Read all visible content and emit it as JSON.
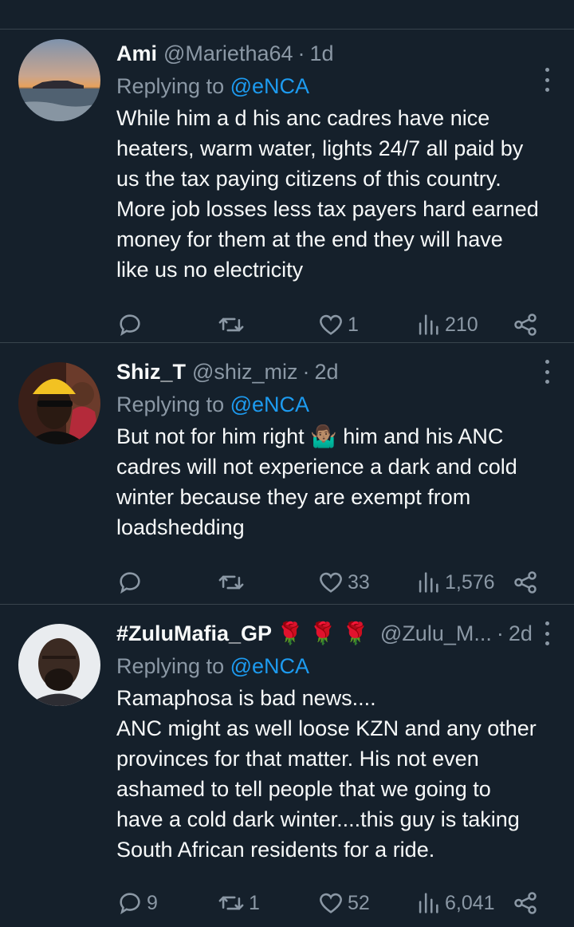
{
  "colors": {
    "background": "#15202b",
    "text": "#f7f9f9",
    "muted": "#8b98a5",
    "link": "#1d9bf0",
    "divider": "#38444d"
  },
  "replies": [
    {
      "name": "Ami",
      "handle": "@Marietha64",
      "time": "1d",
      "replying_prefix": "Replying to",
      "replying_handle": "@eNCA",
      "text": "While him a d his anc cadres have nice\nheaters, warm water, lights 24/7 all paid by\nus the tax paying citizens of this country.\nMore job losses less tax payers hard earned\nmoney for them at the end they will have\nlike us no electricity",
      "replies_count": "",
      "retweets_count": "",
      "likes_count": "1",
      "views_count": "210",
      "avatar": "sunset-beach-photo"
    },
    {
      "name": "Shiz_T",
      "handle": "@shiz_miz",
      "time": "2d",
      "replying_prefix": "Replying to",
      "replying_handle": "@eNCA",
      "text_before_emoji": "But not for him right ",
      "inline_emoji": "🤷🏽‍♂️",
      "text_after_emoji": " him and his ANC\ncadres will not experience a dark and cold\nwinter because they are exempt from\nloadshedding",
      "replies_count": "",
      "retweets_count": "",
      "likes_count": "33",
      "views_count": "1,576",
      "avatar": "man-yellow-beanie-photo"
    },
    {
      "name": "#ZuluMafia_GP",
      "name_emojis": "🌹 🌹 🌹",
      "handle": "@Zulu_M...",
      "time": "2d",
      "replying_prefix": "Replying to",
      "replying_handle": "@eNCA",
      "text": "Ramaphosa is bad news....\nANC might as well loose KZN and any other\nprovinces for that matter. His not even\nashamed to tell people that we going to\nhave a cold dark winter....this guy is taking\nSouth African residents for a ride.",
      "replies_count": "9",
      "retweets_count": "1",
      "likes_count": "52",
      "views_count": "6,041",
      "avatar": "man-portrait-photo"
    }
  ],
  "icons": {
    "reply": "reply-bubble-icon",
    "retweet": "retweet-icon",
    "like": "heart-icon",
    "views": "bar-chart-icon",
    "share": "share-icon",
    "more": "more-options-icon"
  }
}
